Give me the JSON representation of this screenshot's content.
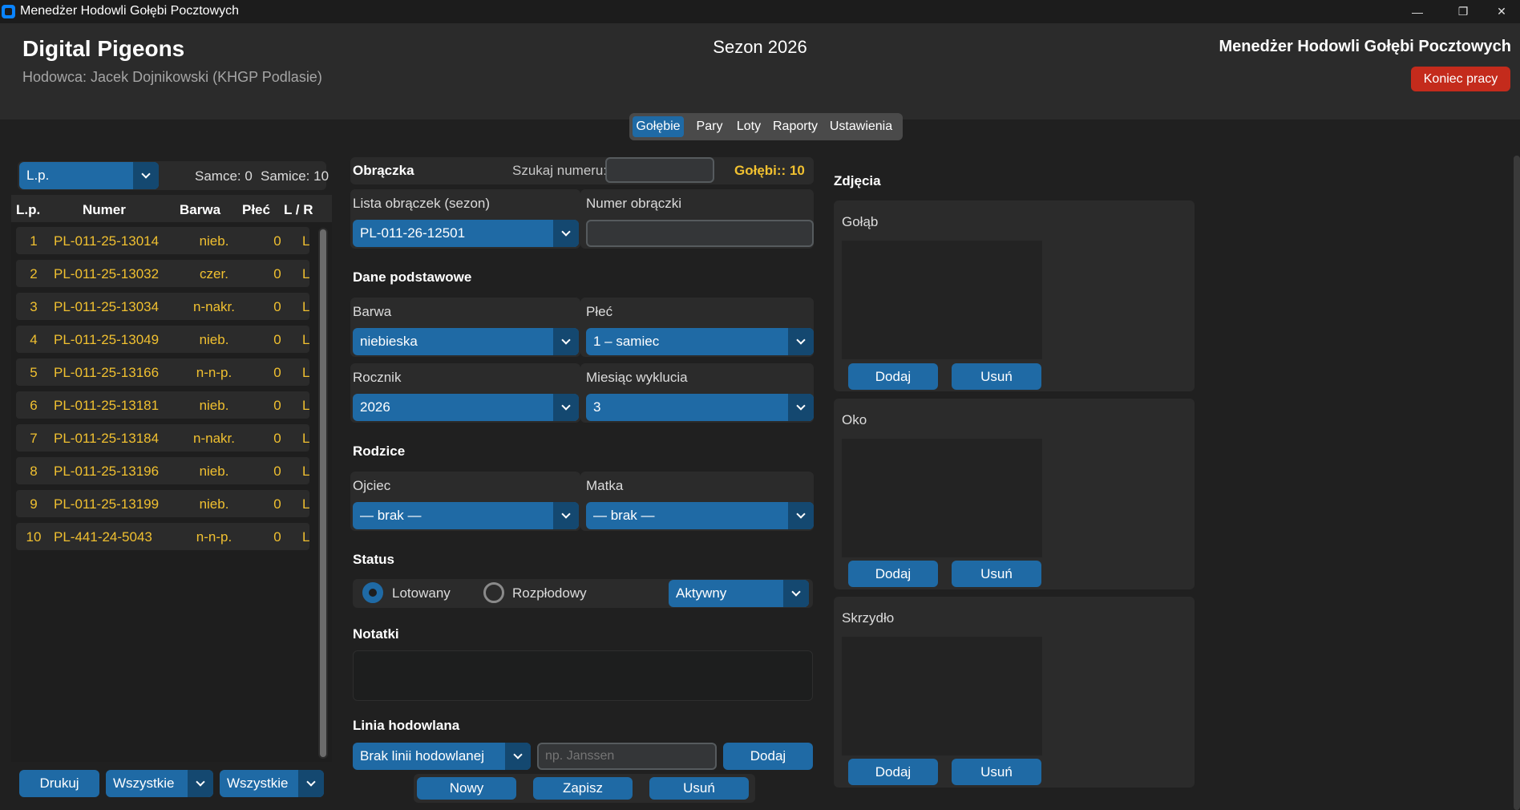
{
  "window": {
    "title": "Menedżer Hodowli Gołębi Pocztowych",
    "min": "—",
    "restore": "❐",
    "close": "✕"
  },
  "header": {
    "app_name": "Digital Pigeons",
    "breeder": "Hodowca: Jacek Dojnikowski (KHGP Podlasie)",
    "season": "Sezon 2026",
    "subtitle": "Menedżer Hodowli Gołębi Pocztowych",
    "end_button": "Koniec pracy"
  },
  "tabs": [
    {
      "label": "Gołębie",
      "active": true
    },
    {
      "label": "Pary",
      "active": false
    },
    {
      "label": "Loty",
      "active": false
    },
    {
      "label": "Raporty",
      "active": false
    },
    {
      "label": "Ustawienia",
      "active": false
    }
  ],
  "left": {
    "sort_select": "L.p.",
    "males": "Samce: 0",
    "females": "Samice: 10",
    "columns": [
      "L.p.",
      "Numer",
      "Barwa",
      "Płeć",
      "L / R"
    ],
    "rows": [
      {
        "lp": "1",
        "numer": "PL-011-25-13014",
        "barwa": "nieb.",
        "plec": "0",
        "lr": "L"
      },
      {
        "lp": "2",
        "numer": "PL-011-25-13032",
        "barwa": "czer.",
        "plec": "0",
        "lr": "L"
      },
      {
        "lp": "3",
        "numer": "PL-011-25-13034",
        "barwa": "n-nakr.",
        "plec": "0",
        "lr": "L"
      },
      {
        "lp": "4",
        "numer": "PL-011-25-13049",
        "barwa": "nieb.",
        "plec": "0",
        "lr": "L"
      },
      {
        "lp": "5",
        "numer": "PL-011-25-13166",
        "barwa": "n-n-p.",
        "plec": "0",
        "lr": "L"
      },
      {
        "lp": "6",
        "numer": "PL-011-25-13181",
        "barwa": "nieb.",
        "plec": "0",
        "lr": "L"
      },
      {
        "lp": "7",
        "numer": "PL-011-25-13184",
        "barwa": "n-nakr.",
        "plec": "0",
        "lr": "L"
      },
      {
        "lp": "8",
        "numer": "PL-011-25-13196",
        "barwa": "nieb.",
        "plec": "0",
        "lr": "L"
      },
      {
        "lp": "9",
        "numer": "PL-011-25-13199",
        "barwa": "nieb.",
        "plec": "0",
        "lr": "L"
      },
      {
        "lp": "10",
        "numer": "PL-441-24-5043",
        "barwa": "n-n-p.",
        "plec": "0",
        "lr": "L"
      }
    ],
    "print_button": "Drukuj",
    "filter1": "Wszystkie",
    "filter2": "Wszystkie"
  },
  "form": {
    "ring_section": "Obrączka",
    "search_label": "Szukaj numeru:",
    "search_value": "",
    "count": "Gołębi:: 10",
    "ring_list_label": "Lista obrączek (sezon)",
    "ring_list_value": "PL-011-26-12501",
    "ring_number_label": "Numer obrączki",
    "ring_number_value": "",
    "basic_section": "Dane podstawowe",
    "color_label": "Barwa",
    "color_value": "niebieska",
    "sex_label": "Płeć",
    "sex_value": "1 – samiec",
    "year_label": "Rocznik",
    "year_value": "2026",
    "month_label": "Miesiąc wyklucia",
    "month_value": "3",
    "parents_section": "Rodzice",
    "father_label": "Ojciec",
    "father_value": "— brak —",
    "mother_label": "Matka",
    "mother_value": "— brak —",
    "status_section": "Status",
    "radio_racing": "Lotowany",
    "radio_racing_checked": true,
    "radio_breeding": "Rozpłodowy",
    "radio_breeding_checked": false,
    "status_value": "Aktywny",
    "notes_section": "Notatki",
    "notes_value": "",
    "line_section": "Linia hodowlana",
    "line_value": "Brak linii hodowlanej",
    "line_placeholder": "np. Janssen",
    "line_add": "Dodaj",
    "btn_new": "Nowy",
    "btn_save": "Zapisz",
    "btn_delete": "Usuń"
  },
  "photos": {
    "section": "Zdjęcia",
    "cards": [
      {
        "label": "Gołąb",
        "add": "Dodaj",
        "remove": "Usuń"
      },
      {
        "label": "Oko",
        "add": "Dodaj",
        "remove": "Usuń"
      },
      {
        "label": "Skrzydło",
        "add": "Dodaj",
        "remove": "Usuń"
      }
    ]
  },
  "colors": {
    "accent": "#1f6aa5",
    "accent_dark": "#144870",
    "danger": "#c42b1c",
    "row_text": "#f0c030"
  }
}
